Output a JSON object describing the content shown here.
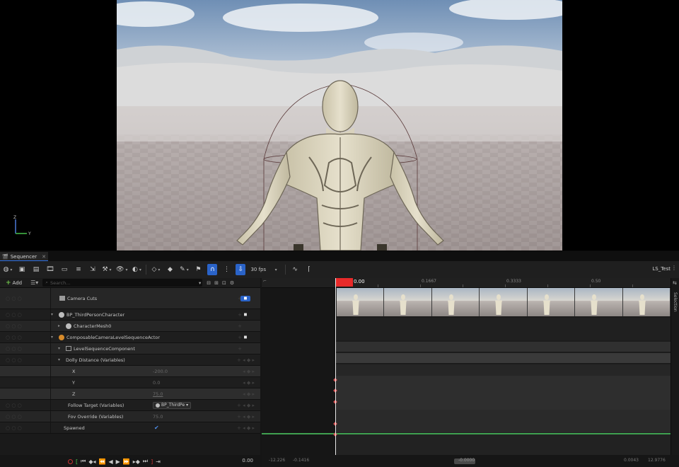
{
  "viewport": {
    "axis": {
      "z_label": "Z",
      "y_label": "Y"
    }
  },
  "sequencer": {
    "tab": {
      "title": "Sequencer"
    },
    "toolbar": {
      "fps": "30 fps",
      "sequence_name": "LS_Test"
    },
    "outliner": {
      "add_label": "Add",
      "search_placeholder": "Search..."
    },
    "tracks": [
      {
        "label": "Camera Cuts"
      },
      {
        "label": "BP_ThirdPersonCharacter"
      },
      {
        "label": "CharacterMesh0"
      },
      {
        "label": "ComposableCameraLevelSequenceActor"
      },
      {
        "label": "LevelSequenceComponent"
      },
      {
        "label": "Dolly Distance (Variables)"
      },
      {
        "label": "X",
        "value": "-200.0"
      },
      {
        "label": "Y",
        "value": "0.0"
      },
      {
        "label": "Z",
        "value": "75.0"
      },
      {
        "label": "Follow Target (Variables)",
        "value": "BP_ThirdPe"
      },
      {
        "label": "Fov Override (Variables)",
        "value": "75.0"
      },
      {
        "label": "Spawned"
      }
    ],
    "timeline": {
      "playhead_time": "0.00",
      "ticks": [
        "0.1667",
        "0.3333",
        "0.50"
      ]
    },
    "sidebar": {
      "label": "Selection"
    },
    "transport": {
      "time": "0.00",
      "view_start": "-12.226",
      "play_start": "-0.1416",
      "scroll_label": "-0.0000",
      "play_end": "0.0043",
      "view_end": "12.9776"
    }
  }
}
